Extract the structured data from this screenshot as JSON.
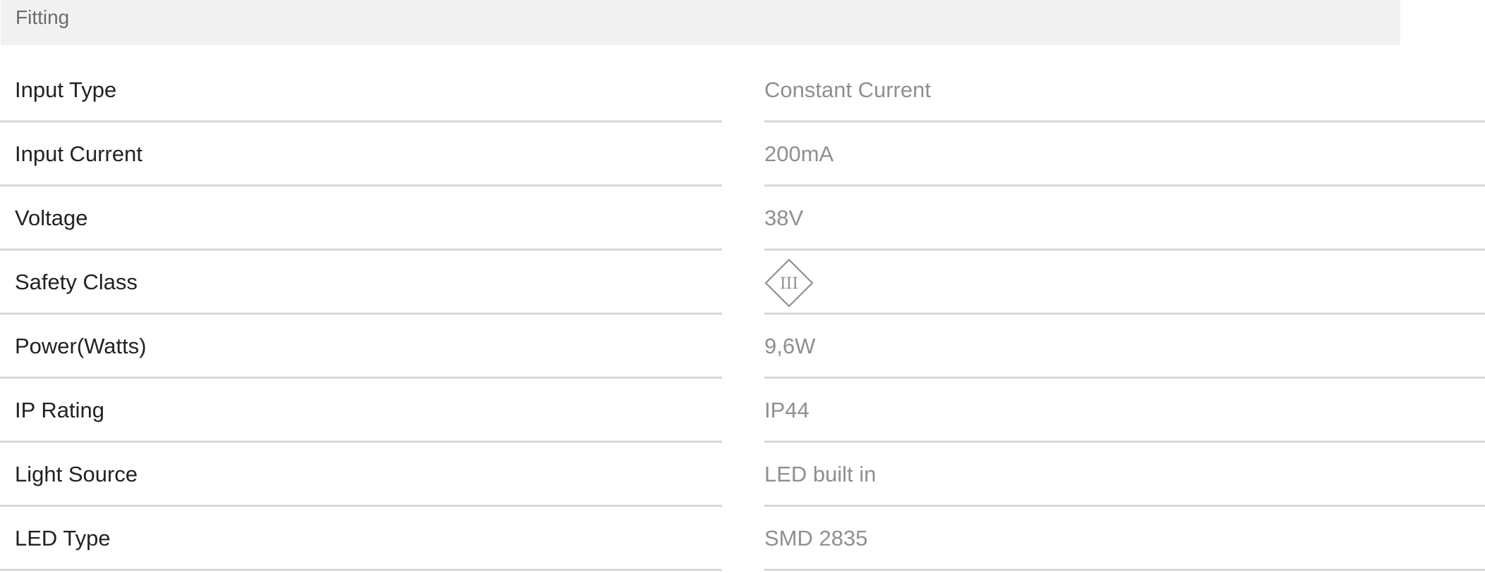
{
  "section": {
    "title": "Fitting"
  },
  "specs": [
    {
      "label": "Input Type",
      "value": "Constant Current"
    },
    {
      "label": "Input Current",
      "value": "200mA"
    },
    {
      "label": "Voltage",
      "value": "38V"
    },
    {
      "label": "Safety Class",
      "value": "III",
      "icon": "safety-class-iii-diamond-icon"
    },
    {
      "label": "Power(Watts)",
      "value": "9,6W"
    },
    {
      "label": "IP Rating",
      "value": "IP44"
    },
    {
      "label": "Light Source",
      "value": "LED built in"
    },
    {
      "label": "LED Type",
      "value": "SMD 2835"
    }
  ],
  "colors": {
    "header_bg": "#f1f1f1",
    "header_text": "#6b6b6b",
    "label_text": "#222222",
    "value_text": "#8f8f8f",
    "divider": "#d9d9d9"
  }
}
